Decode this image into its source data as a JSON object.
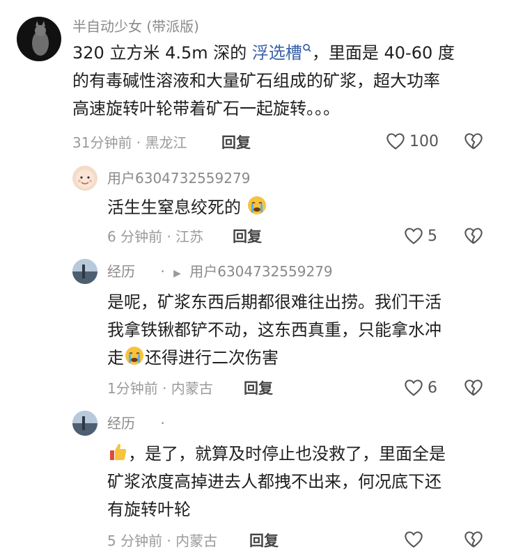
{
  "comments": [
    {
      "author": "半自动少女 (带派版)",
      "text_prefix": "320 立方米 4.5m 深的 ",
      "link_text": "浮选槽",
      "text_line1_suffix": "，里面是 40-60 度",
      "text_line2": "的有毒碱性溶液和大量矿石组成的矿浆，超大功率",
      "text_line3": "高速旋转叶轮带着矿石一起旋转。。。",
      "time": "31分钟前 · 黑龙江",
      "reply_label": "回复",
      "likes": "100"
    },
    {
      "author": "用户6304732559279",
      "text_line1": "活生生窒息绞死的",
      "time": "6 分钟前 · 江苏",
      "reply_label": "回复",
      "likes": "5"
    },
    {
      "author": "经历",
      "reply_to": "用户6304732559279",
      "text_line1": "是呢，矿浆东西后期都很难往出捞。我们干活",
      "text_line2": "我拿铁锹都铲不动，这东西真重，只能拿水冲",
      "text_line3_prefix": "走",
      "text_line3_suffix": "还得进行二次伤害",
      "time": "1分钟前 · 内蒙古",
      "reply_label": "回复",
      "likes": "6"
    },
    {
      "author": "经历",
      "text_line1_suffix": "，是了，就算及时停止也没救了，里面全是",
      "text_line2": "矿浆浓度高掉进去人都拽不出来，何况底下还",
      "text_line3": "有旋转叶轮",
      "time": "5 分钟前 · 内蒙古",
      "reply_label": "回复"
    }
  ],
  "colors": {
    "link": "#3a62a8",
    "meta": "#9a9a9a",
    "text": "#1f1f1f"
  }
}
